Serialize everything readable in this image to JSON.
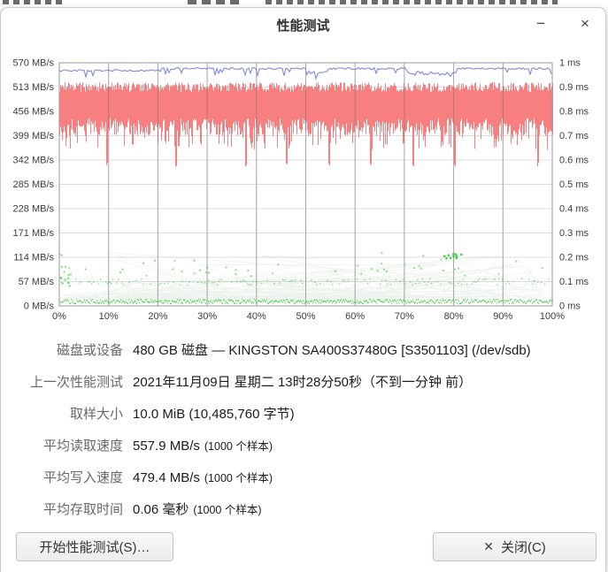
{
  "window": {
    "title": "性能测试",
    "minimize_glyph": "−",
    "close_glyph": "×"
  },
  "chart_data": {
    "type": "line",
    "title": "",
    "samples_per_series": 1000,
    "grid": true,
    "seed": 7,
    "x_axis": {
      "range_percent": [
        0,
        100
      ],
      "ticks": [
        "0%",
        "10%",
        "20%",
        "30%",
        "40%",
        "50%",
        "60%",
        "70%",
        "80%",
        "90%",
        "100%"
      ]
    },
    "y_left_axis": {
      "unit": "MB/s",
      "range": [
        0,
        570
      ],
      "ticks": [
        "570 MB/s",
        "513 MB/s",
        "456 MB/s",
        "399 MB/s",
        "342 MB/s",
        "285 MB/s",
        "228 MB/s",
        "171 MB/s",
        "114 MB/s",
        "57 MB/s",
        "0 MB/s"
      ]
    },
    "y_right_axis": {
      "unit": "ms",
      "range": [
        0,
        1
      ],
      "ticks": [
        "1 ms",
        "0.9 ms",
        "0.8 ms",
        "0.7 ms",
        "0.6 ms",
        "0.5 ms",
        "0.4 ms",
        "0.3 ms",
        "0.2 ms",
        "0.1 ms",
        "0 ms"
      ]
    },
    "series": [
      {
        "name": "read-rate",
        "color": "#7a83dc",
        "average_mb_s": 557.9,
        "base_mb_s_before_20pct": 551.5,
        "base_mb_s_after_20pct": 556.5,
        "dip_segments": [
          {
            "from_pct": 50,
            "to_pct": 54.5,
            "mb_s": 546
          },
          {
            "from_pct": 70.5,
            "to_pct": 80.5,
            "mb_s": 545
          }
        ]
      },
      {
        "name": "write-rate",
        "color": "#f87f80",
        "average_mb_s": 479.4,
        "top_mb_s_range": [
          502,
          524
        ],
        "bottom_mb_s_range": [
          398,
          440
        ],
        "deep_dip_percents": [
          9.5,
          23.5,
          37.7,
          46,
          54.6,
          63,
          71.6,
          80,
          97
        ],
        "deep_dip_mb_s": 330
      },
      {
        "name": "access-time",
        "color": "#3ed43e",
        "web_color": "rgba(110,160,110,0.12)",
        "average_ms": 0.06,
        "dense_band_ms": 0.02,
        "second_band_ms": 0.1,
        "max_scatter_ms": 0.22,
        "cluster_percent": 79.5,
        "cluster_ms": 0.2
      }
    ]
  },
  "details": {
    "rows": [
      {
        "label": "磁盘或设备",
        "value": "480 GB 磁盘 — KINGSTON SA400S37480G [S3501103] (/dev/sdb)",
        "note": ""
      },
      {
        "label": "上一次性能测试",
        "value": "2021年11月09日 星期二 13时28分50秒（不到一分钟 前）",
        "note": ""
      },
      {
        "label": "取样大小",
        "value": "10.0 MiB (10,485,760 字节)",
        "note": ""
      },
      {
        "label": "平均读取速度",
        "value": "557.9 MB/s",
        "note": "(1000 个样本)"
      },
      {
        "label": "平均写入速度",
        "value": "479.4 MB/s",
        "note": "(1000 个样本)"
      },
      {
        "label": "平均存取时间",
        "value": "0.06 毫秒",
        "note": "(1000 个样本)"
      }
    ]
  },
  "footer": {
    "start_button": "开始性能测试(S)…",
    "close_button": "关闭(C)",
    "close_icon": "✕"
  }
}
